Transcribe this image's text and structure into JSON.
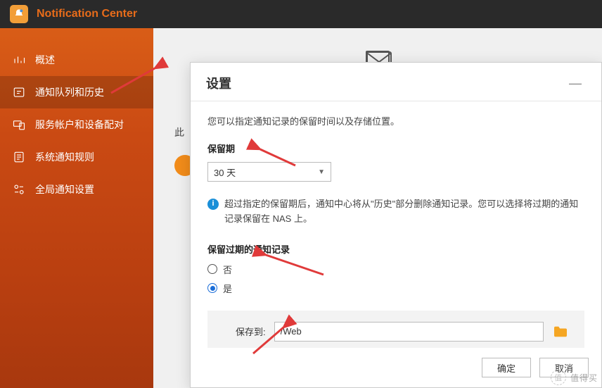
{
  "app": {
    "title": "Notification Center"
  },
  "sidebar": {
    "items": [
      {
        "label": "概述"
      },
      {
        "label": "通知队列和历史"
      },
      {
        "label": "服务帐户和设备配对"
      },
      {
        "label": "系统通知规则"
      },
      {
        "label": "全局通知设置"
      }
    ],
    "active_index": 1
  },
  "behind": {
    "text_prefix": "此"
  },
  "dialog": {
    "title": "设置",
    "description": "您可以指定通知记录的保留时间以及存储位置。",
    "retention_label": "保留期",
    "retention_value": "30 天",
    "info_text": "超过指定的保留期后，通知中心将从\"历史\"部分删除通知记录。您可以选择将过期的通知记录保留在 NAS 上。",
    "expired_label": "保留过期的通知记录",
    "option_no": "否",
    "option_yes": "是",
    "selected_option": "yes",
    "save_to_label": "保存到:",
    "save_to_value": "/Web",
    "ok_label": "确定",
    "cancel_label": "取消"
  },
  "watermark": "值得买"
}
